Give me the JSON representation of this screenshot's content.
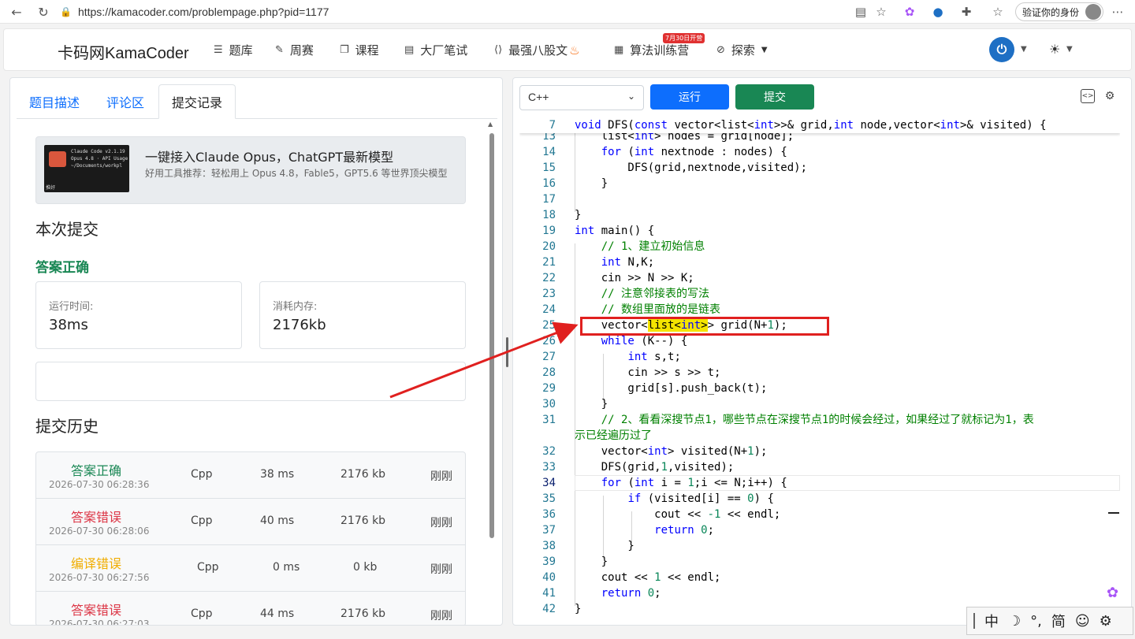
{
  "browser": {
    "url": "https://kamacoder.com/problempage.php?pid=1177",
    "profile_label": "验证你的身份"
  },
  "header": {
    "brand": "卡码网KamaCoder",
    "nav": [
      "题库",
      "周赛",
      "课程",
      "大厂笔试",
      "最强八股文",
      "算法训练营",
      "探索"
    ],
    "badge": "7月30日开营"
  },
  "left": {
    "tabs": [
      "题目描述",
      "评论区",
      "提交记录"
    ],
    "ad": {
      "title": "一键接入Claude Opus，ChatGPT最新模型",
      "subtitle": "好用工具推荐：轻松用上 Opus 4.8，Fable5，GPT5.6 等世界顶尖模型",
      "thumb_lines": [
        "Claude Code v2.1.19",
        "Opus 4.8 · API Usage",
        "~/Documents/workpl"
      ],
      "thumb_tag": "推好"
    },
    "current_title": "本次提交",
    "verdict": "答案正确",
    "runtime_label": "运行时间:",
    "runtime_value": "38ms",
    "memory_label": "消耗内存:",
    "memory_value": "2176kb",
    "history_title": "提交历史",
    "history": [
      {
        "status": "答案正确",
        "time": "2026-07-30 06:28:36",
        "lang": "Cpp",
        "runtime": "38 ms",
        "memory": "2176 kb",
        "ago": "刚刚"
      },
      {
        "status": "答案错误",
        "time": "2026-07-30 06:28:06",
        "lang": "Cpp",
        "runtime": "40 ms",
        "memory": "2176 kb",
        "ago": "刚刚"
      },
      {
        "status": "编译错误",
        "time": "2026-07-30 06:27:56",
        "lang": "Cpp",
        "runtime": "0 ms",
        "memory": "0 kb",
        "ago": "刚刚"
      },
      {
        "status": "答案错误",
        "time": "2026-07-30 06:27:03",
        "lang": "Cpp",
        "runtime": "44 ms",
        "memory": "2176 kb",
        "ago": "刚刚"
      }
    ]
  },
  "right": {
    "language": "C++",
    "run_label": "运行",
    "submit_label": "提交"
  },
  "colors": {
    "correct": "#198754",
    "wrong": "#dc3545",
    "compile_error": "#f0ad00",
    "primary": "#0d6efd"
  },
  "ime": [
    "中",
    "☽",
    "°,",
    "简",
    "☺",
    "⚙"
  ]
}
